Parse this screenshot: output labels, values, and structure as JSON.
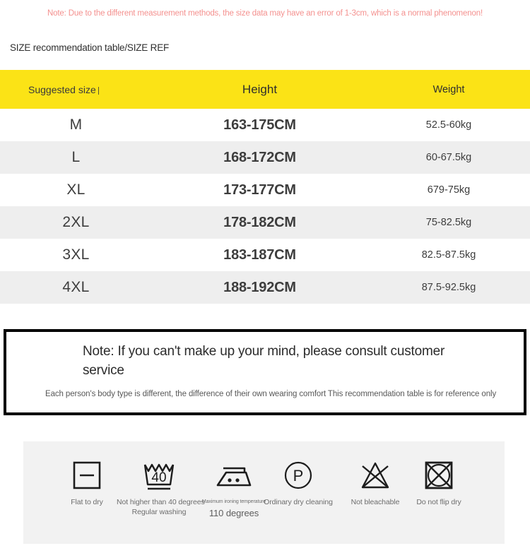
{
  "top_note": "Note: Due to the different measurement methods, the size data may have an error of 1-3cm, which is a normal phenomenon!",
  "section_title": "SIZE recommendation table/SIZE REF",
  "colors": {
    "header_yellow": "#FBE316",
    "note_red": "#F4918F",
    "row_alt_gray": "#EEEEEE",
    "panel_gray": "#F2F2F2",
    "border_black": "#000000"
  },
  "table": {
    "columns": [
      "Suggested size",
      "Height",
      "Weight"
    ],
    "rows": [
      {
        "size": "M",
        "height": "163-175CM",
        "weight": "52.5-60kg"
      },
      {
        "size": "L",
        "height": "168-172CM",
        "weight": "60-67.5kg"
      },
      {
        "size": "XL",
        "height": "173-177CM",
        "weight": "679-75kg"
      },
      {
        "size": "2XL",
        "height": "178-182CM",
        "weight": "75-82.5kg"
      },
      {
        "size": "3XL",
        "height": "183-187CM",
        "weight": "82.5-87.5kg"
      },
      {
        "size": "4XL",
        "height": "188-192CM",
        "weight": "87.5-92.5kg"
      }
    ]
  },
  "note_box": {
    "headline": "Note: If you can't make up your mind, please consult customer service",
    "subtext": "Each person's body type is different, the difference of their own wearing comfort This recommendation table is for reference only"
  },
  "care_symbols": [
    {
      "icon": "flat-to-dry-icon",
      "label": "Flat to dry",
      "label2": ""
    },
    {
      "icon": "wash-40-icon",
      "label": "Not higher than 40 degrees",
      "label2": "Regular washing"
    },
    {
      "icon": "iron-two-dots-icon",
      "label": "Maximum ironing temperature",
      "label2": "110 degrees"
    },
    {
      "icon": "dry-clean-p-icon",
      "label": "Ordinary dry cleaning",
      "label2": ""
    },
    {
      "icon": "no-bleach-icon",
      "label": "Not bleachable",
      "label2": ""
    },
    {
      "icon": "no-tumble-dry-icon",
      "label": "Do not flip dry",
      "label2": ""
    }
  ],
  "wash_temp_value": "40"
}
